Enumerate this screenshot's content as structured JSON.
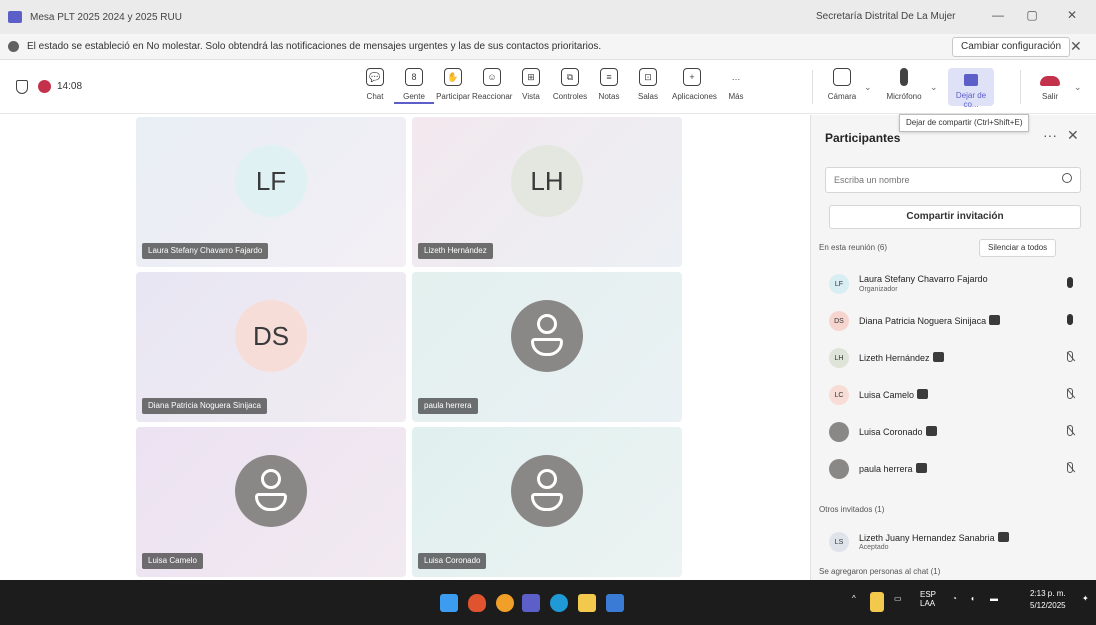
{
  "window": {
    "title": "Mesa PLT 2025 2024 y 2025 RUU",
    "org": "Secretaría Distrital De La Mujer",
    "minimize": "—",
    "maximize": "▢",
    "close": "✕"
  },
  "notification": {
    "message": "El estado se estableció en No molestar. Solo obtendrá las notificaciones de mensajes urgentes y las de sus contactos prioritarios.",
    "change_label": "Cambiar configuración",
    "close": "✕"
  },
  "toolbar": {
    "timer": "14:08",
    "items": [
      {
        "label": "Chat",
        "icon": "chat-icon",
        "glyph": "💬"
      },
      {
        "label": "Gente",
        "icon": "people-icon",
        "glyph": "8"
      },
      {
        "label": "Participar",
        "icon": "raise-hand-icon",
        "glyph": "✋"
      },
      {
        "label": "Reaccionar",
        "icon": "smile-icon",
        "glyph": "☺"
      },
      {
        "label": "Vista",
        "icon": "grid-view-icon",
        "glyph": "⊞"
      },
      {
        "label": "Controles",
        "icon": "controls-icon",
        "glyph": "⧉"
      },
      {
        "label": "Notas",
        "icon": "notes-icon",
        "glyph": "≡"
      },
      {
        "label": "Salas",
        "icon": "rooms-icon",
        "glyph": "⊡"
      },
      {
        "label": "Aplicaciones",
        "icon": "apps-icon",
        "glyph": "+"
      },
      {
        "label": "Más",
        "icon": "more-icon",
        "glyph": "…"
      }
    ],
    "camera_label": "Cámara",
    "mic_label": "Micrófono",
    "share_label": "Dejar de co...",
    "leave_label": "Salir"
  },
  "tooltip": "Dejar de compartir (Ctrl+Shift+E)",
  "tiles": [
    {
      "initials": "LF",
      "name": "Laura Stefany Chavarro Fajardo",
      "bg": "linear-gradient(135deg,#e9eef5,#f3eff5)",
      "avatar_bg": "#dff1f3"
    },
    {
      "initials": "LH",
      "name": "Lizeth Hernández",
      "bg": "linear-gradient(135deg,#f2e8ee,#ecf0f4)",
      "avatar_bg": "#e4e7e0"
    },
    {
      "initials": "DS",
      "name": "Diana Patricia Noguera Sinijaca",
      "bg": "linear-gradient(135deg,#e8e6f3,#f1ecf2)",
      "avatar_bg": "#f6ddd8"
    },
    {
      "initials": "",
      "name": "paula herrera",
      "bg": "linear-gradient(135deg,#e3f0ee,#eaf1f4)",
      "avatar_bg": "#8a8886"
    },
    {
      "initials": "",
      "name": "Luisa Camelo",
      "bg": "linear-gradient(135deg,#ece2f2,#f2eaf1)",
      "avatar_bg": "#8a8886"
    },
    {
      "initials": "",
      "name": "Luisa Coronado",
      "bg": "linear-gradient(135deg,#e0f0ef,#ecf3f2)",
      "avatar_bg": "#8a8886"
    }
  ],
  "panel": {
    "title": "Participantes",
    "search_placeholder": "Escriba un nombre",
    "invite_label": "Compartir invitación",
    "in_meeting": "En esta reunión (6)",
    "mute_all": "Silenciar a todos",
    "participants": [
      {
        "initials": "LF",
        "name": "Laura Stefany Chavarro Fajardo",
        "role": "Organizador",
        "avatar_bg": "#d9eef2",
        "mic": "on"
      },
      {
        "initials": "DS",
        "name": "Diana Patricia Noguera Sinijaca",
        "role": "",
        "avatar_bg": "#f6d5cf",
        "mic": "on"
      },
      {
        "initials": "LH",
        "name": "Lizeth Hernández",
        "role": "",
        "avatar_bg": "#dfe4d8",
        "mic": "off"
      },
      {
        "initials": "LC",
        "name": "Luisa Camelo",
        "role": "",
        "avatar_bg": "#f7ddd6",
        "mic": "off"
      },
      {
        "initials": "",
        "name": "Luisa Coronado",
        "role": "",
        "avatar_bg": "#8a8886",
        "mic": "off"
      },
      {
        "initials": "",
        "name": "paula herrera",
        "role": "",
        "avatar_bg": "#8a8886",
        "mic": "off"
      }
    ],
    "others_invited": "Otros invitados (1)",
    "invited": {
      "initials": "LS",
      "name": "Lizeth Juany Hernandez Sanabria",
      "role": "Aceptado",
      "avatar_bg": "#dfe4ea"
    },
    "chat_section": "Se agregaron personas al chat (1)"
  },
  "taskbar": {
    "lang_top": "ESP",
    "lang_bottom": "LAA",
    "time": "2:13 p. m.",
    "date": "5/12/2025"
  }
}
